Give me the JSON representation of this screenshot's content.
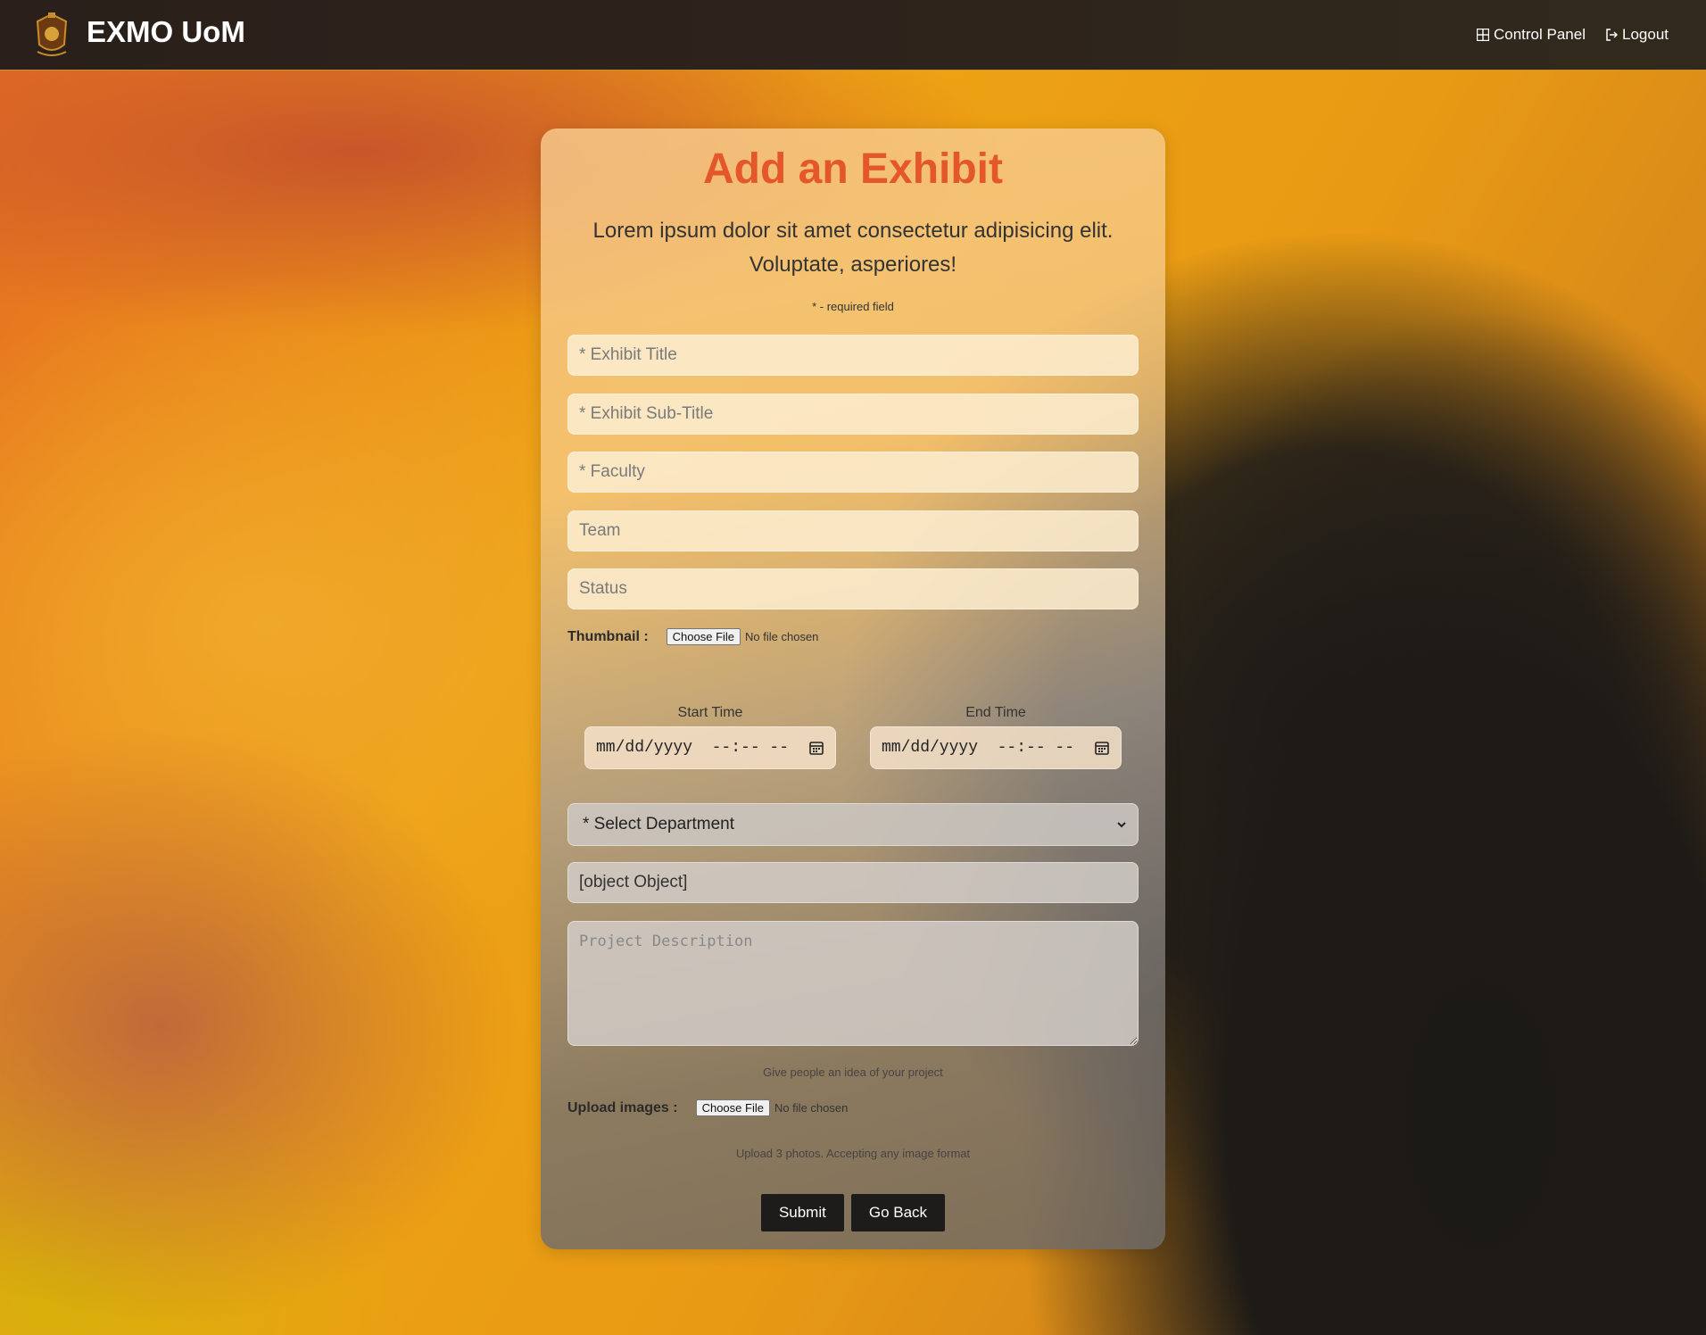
{
  "navbar": {
    "brand": "EXMO UoM",
    "control_panel_label": "Control Panel",
    "logout_label": "Logout"
  },
  "form": {
    "title": "Add an Exhibit",
    "lead": "Lorem ipsum dolor sit amet consectetur adipisicing elit. Voluptate, asperiores!",
    "required_note": "* - required field",
    "exhibit_title": {
      "placeholder": "* Exhibit Title",
      "value": ""
    },
    "exhibit_subtitle": {
      "placeholder": "* Exhibit Sub-Title",
      "value": ""
    },
    "faculty": {
      "placeholder": "* Faculty",
      "value": ""
    },
    "team": {
      "placeholder": "Team",
      "value": ""
    },
    "status": {
      "placeholder": "Status",
      "value": ""
    },
    "thumbnail": {
      "label": "Thumbnail :",
      "button": "Choose File",
      "status": "No file chosen"
    },
    "start_time": {
      "label": "Start Time",
      "value": "mm/dd/yyyy  --:-- --"
    },
    "end_time": {
      "label": "End Time",
      "value": "mm/dd/yyyy  --:-- --"
    },
    "department": {
      "selected": "* Select Department"
    },
    "object_field": {
      "value": "[object Object]"
    },
    "description": {
      "placeholder": "Project Description",
      "hint": "Give people an idea of your project"
    },
    "upload_images": {
      "label": "Upload images :",
      "button": "Choose File",
      "status": "No file chosen",
      "hint": "Upload 3 photos. Accepting any image format"
    },
    "submit_label": "Submit",
    "go_back_label": "Go Back"
  },
  "colors": {
    "title": "#e4572a",
    "navbar": "#2a1f1a",
    "button": "#1d1c1a"
  },
  "icons": {
    "logo": "university-crest-icon",
    "control_panel": "grid-icon",
    "logout": "sign-out-icon",
    "calendar": "calendar-icon",
    "select": "chevron-down-icon"
  }
}
